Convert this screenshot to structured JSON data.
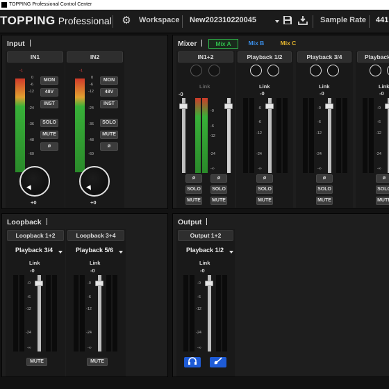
{
  "window": {
    "title": "TOPPING Professional Control Center"
  },
  "topbar": {
    "logo_brand": "TOPPING",
    "logo_sub": "Professional",
    "workspace_label": "Workspace",
    "workspace_name": "New202310220045",
    "sample_rate_label": "Sample Rate",
    "sample_rate_value": "441"
  },
  "input": {
    "title": "Input",
    "scale": [
      "-1",
      "0",
      "-6",
      "-12",
      "-24",
      "-36",
      "-48",
      "-60"
    ],
    "channels": [
      {
        "name": "IN1",
        "gain": "+0",
        "buttons": [
          "MON",
          "48V",
          "INST",
          "SOLO",
          "MUTE",
          "ø"
        ]
      },
      {
        "name": "IN2",
        "gain": "+0",
        "buttons": [
          "MON",
          "48V",
          "INST",
          "SOLO",
          "MUTE",
          "ø"
        ]
      }
    ]
  },
  "mixer": {
    "title": "Mixer",
    "tabs": [
      {
        "label": "Mix A",
        "color": "#2fb84a"
      },
      {
        "label": "Mix B",
        "color": "#3a8ee8"
      },
      {
        "label": "Mix C",
        "color": "#e3b42e"
      }
    ],
    "link_label": "Link",
    "fader_value": "-0",
    "scale": [
      "-0",
      "-6",
      "-12",
      "-24",
      "-∞"
    ],
    "channels": [
      {
        "name": "IN1+2",
        "buttons": [
          "ø",
          "SOLO",
          "MUTE"
        ]
      },
      {
        "name": "Playback 1/2",
        "buttons": [
          "ø",
          "SOLO",
          "MUTE"
        ]
      },
      {
        "name": "Playback 3/4",
        "buttons": [
          "ø",
          "SOLO",
          "MUTE"
        ]
      },
      {
        "name": "Playback",
        "buttons": [
          "ø",
          "SOLO",
          "MUTE"
        ]
      }
    ]
  },
  "loopback": {
    "title": "Loopback",
    "link_label": "Link",
    "fader_value": "-0",
    "scale": [
      "-0",
      "-6",
      "-12",
      "-24",
      "-∞"
    ],
    "channels": [
      {
        "name": "Loopback 1+2",
        "source": "Playback 3/4",
        "button": "MUTE"
      },
      {
        "name": "Loopback 3+4",
        "source": "Playback 5/6",
        "button": "MUTE"
      }
    ]
  },
  "output": {
    "title": "Output",
    "link_label": "Link",
    "fader_value": "-0",
    "scale": [
      "-0",
      "-6",
      "-12",
      "-24",
      "-∞"
    ],
    "channels": [
      {
        "name": "Output 1+2",
        "source": "Playback 1/2",
        "icons": [
          "headphone-icon",
          "guitar-icon"
        ]
      }
    ]
  }
}
